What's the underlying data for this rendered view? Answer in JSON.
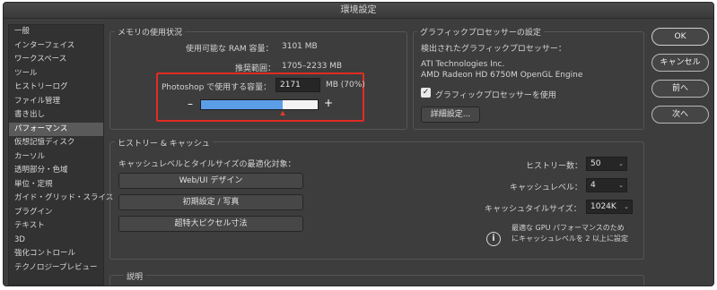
{
  "window": {
    "title": "環境設定"
  },
  "sidebar": {
    "items": [
      {
        "label": "一般"
      },
      {
        "label": "インターフェイス"
      },
      {
        "label": "ワークスペース"
      },
      {
        "label": "ツール"
      },
      {
        "label": "ヒストリーログ"
      },
      {
        "label": "ファイル管理"
      },
      {
        "label": "書き出し"
      },
      {
        "label": "パフォーマンス",
        "active": true
      },
      {
        "label": "仮想記憶ディスク"
      },
      {
        "label": "カーソル"
      },
      {
        "label": "透明部分・色域"
      },
      {
        "label": "単位・定規"
      },
      {
        "label": "ガイド・グリッド・スライス"
      },
      {
        "label": "プラグイン"
      },
      {
        "label": "テキスト"
      },
      {
        "label": "3D"
      },
      {
        "label": "強化コントロール"
      },
      {
        "label": "テクノロジープレビュー"
      }
    ]
  },
  "memory": {
    "title": "メモリの使用状況",
    "available_label": "使用可能な RAM 容量：",
    "available_value": "3101 MB",
    "range_label": "推奨範囲：",
    "range_value": "1705–2233 MB",
    "use_label": "Photoshop で使用する容量：",
    "use_value": "2171",
    "use_unit": "MB (70%)",
    "minus": "–",
    "plus": "+",
    "slider_fraction": 0.7
  },
  "gpu": {
    "title": "グラフィックプロセッサーの設定",
    "detected_label": "検出されたグラフィックプロセッサー：",
    "vendor": "ATI Technologies Inc.",
    "model": "AMD Radeon HD 6750M OpenGL Engine",
    "use_gpu_label": "グラフィックプロセッサーを使用",
    "use_gpu_checked": true,
    "advanced_button": "詳細設定..."
  },
  "history": {
    "title": "ヒストリー & キャッシュ",
    "optimize_label": "キャッシュレベルとタイルサイズの最適化対象：",
    "buttons": [
      "Web/UI デザイン",
      "初期設定 / 写真",
      "超特大ピクセル寸法"
    ],
    "history_states_label": "ヒストリー数：",
    "history_states_value": "50",
    "cache_levels_label": "キャッシュレベル：",
    "cache_levels_value": "4",
    "tile_size_label": "キャッシュタイルサイズ：",
    "tile_size_value": "1024K",
    "info_line1": "最適な GPU パフォーマンスのため",
    "info_line2": "にキャッシュレベルを 2 以上に設定"
  },
  "description": {
    "title": "説明"
  },
  "actions": {
    "ok": "OK",
    "cancel": "キャンセル",
    "prev": "前へ",
    "next": "次へ"
  },
  "colors": {
    "accent_fill": "#5b9ee8",
    "highlight": "#e22b24",
    "panel": "#3d3d3d"
  },
  "icons": {
    "checkbox": "checkmark-icon",
    "info": "info-icon",
    "chevron": "chevron-down-icon"
  }
}
